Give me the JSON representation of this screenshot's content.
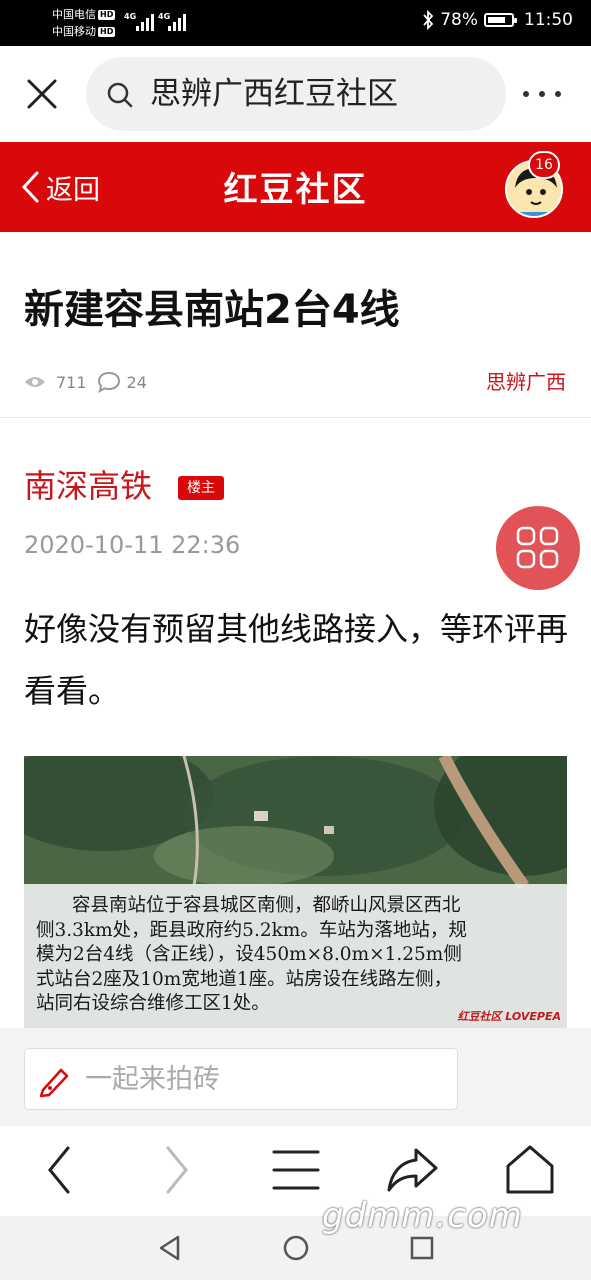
{
  "status_bar": {
    "carrier1": "中国电信",
    "carrier2": "中国移动",
    "hd": "HD",
    "net1": "4G",
    "net2": "4G",
    "battery": "78%",
    "battery_level": 0.78,
    "time": "11:50"
  },
  "browser": {
    "url_title": "思辨广西红豆社区"
  },
  "header": {
    "back_label": "返回",
    "brand": "红豆社区",
    "notification_count": "16"
  },
  "thread": {
    "title": "新建容县南站2台4线",
    "views": "711",
    "replies": "24",
    "section": "思辨广西"
  },
  "post": {
    "author": "南深高铁",
    "author_badge": "楼主",
    "time": "2020-10-11 22:36",
    "content": "好像没有预留其他线路接入，等环评再看看。",
    "image_caption_lines": [
      "容县南站位于容县城区南侧，都峤山风景区西北",
      "侧3.3km处，距县政府约5.2km。车站为落地站，规",
      "模为2台4线（含正线），设450m×8.0m×1.25m侧",
      "式站台2座及10m宽地道1座。站房设在线路左侧，",
      "站同右设综合维修工区1处。"
    ],
    "image_watermark": "红豆社区 LOVEPEA"
  },
  "comment": {
    "placeholder": "一起来拍砖"
  },
  "watermark": "gdmm.com",
  "icons": {
    "close": "close-icon",
    "search": "search-icon",
    "more": "more-icon",
    "back": "chevron-left-icon",
    "eye": "eye-icon",
    "reply": "comment-icon",
    "floor_menu": "grid-icon",
    "pencil": "pencil-icon",
    "nav_back": "back-arrow-icon",
    "nav_forward": "forward-arrow-icon",
    "nav_menu": "menu-icon",
    "nav_share": "share-icon",
    "nav_home": "home-icon"
  },
  "colors": {
    "brand_red": "#d9090b",
    "author_red": "#c8161d"
  }
}
